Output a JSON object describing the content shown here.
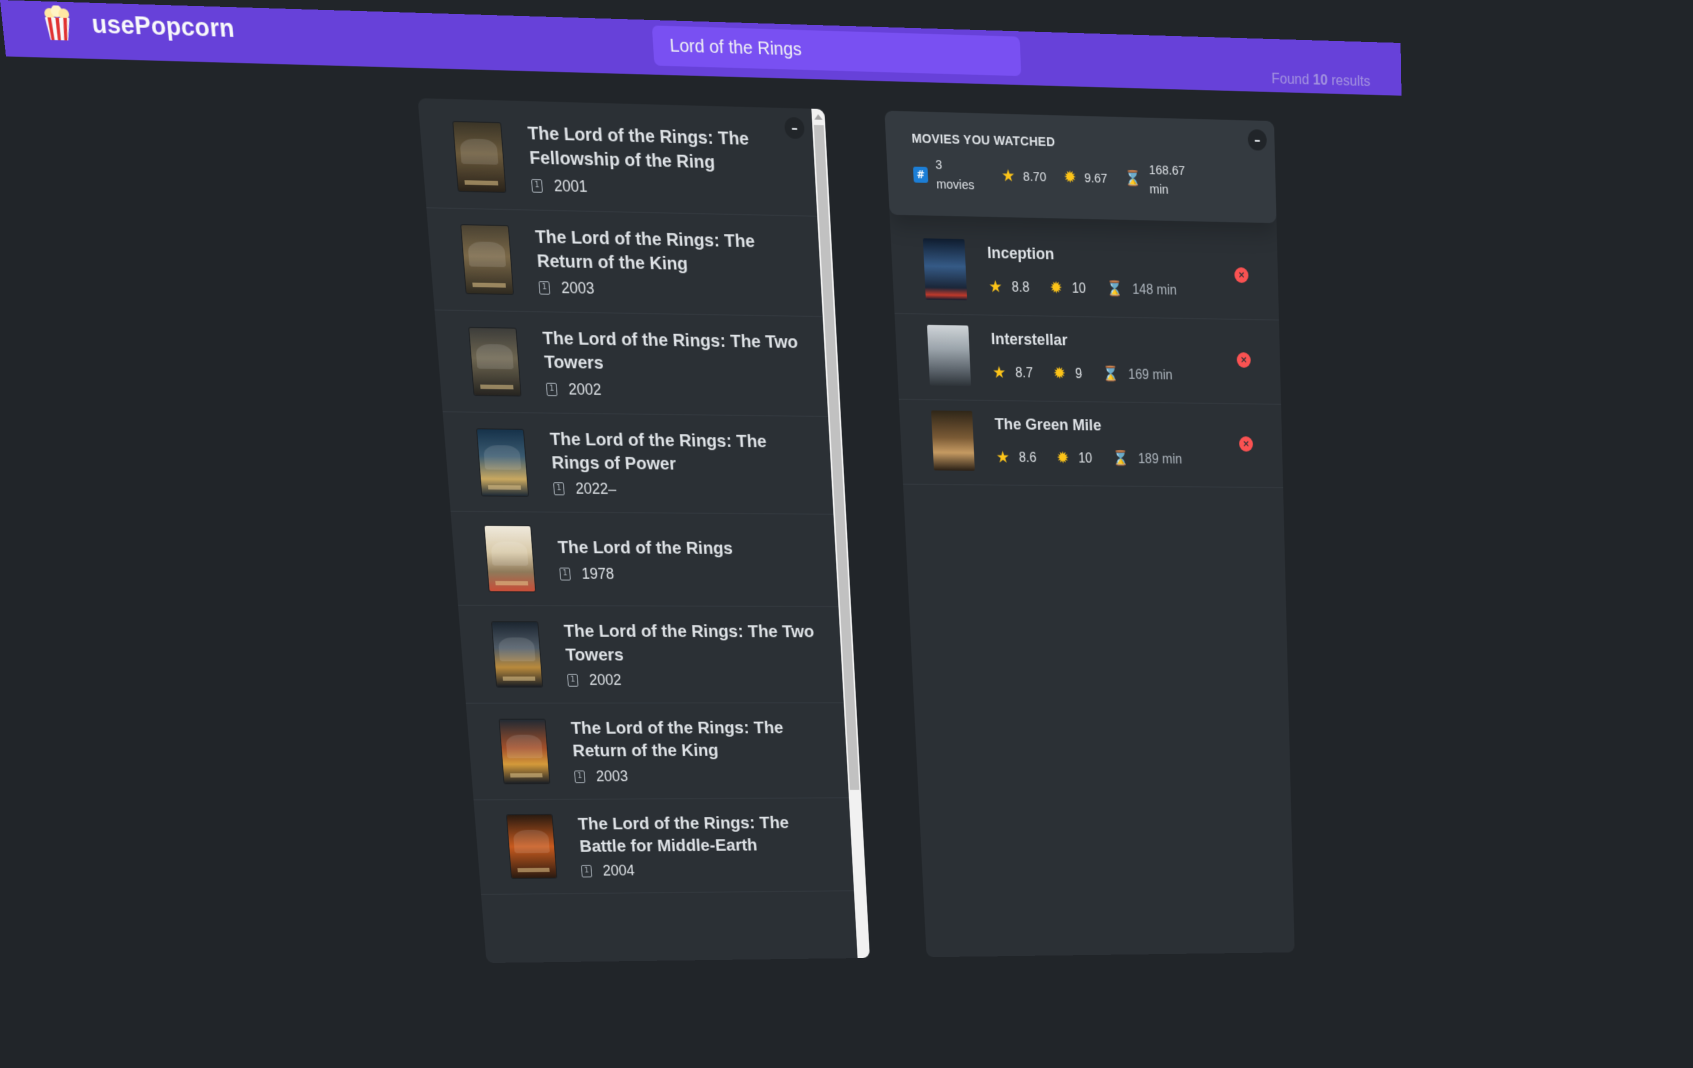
{
  "app": {
    "name": "usePopcorn",
    "logo_icon": "popcorn-icon",
    "accent_color": "#6741d9"
  },
  "search": {
    "value": "Lord of the Rings",
    "placeholder": "Search movies..."
  },
  "results": {
    "prefix": "Found",
    "count": "10",
    "suffix": "results"
  },
  "movie_list": {
    "toggle_label": "–",
    "items": [
      {
        "title": "The Lord of the Rings: The Fellowship of the Ring",
        "year": "2001"
      },
      {
        "title": "The Lord of the Rings: The Return of the King",
        "year": "2003"
      },
      {
        "title": "The Lord of the Rings: The Two Towers",
        "year": "2002"
      },
      {
        "title": "The Lord of the Rings: The Rings of Power",
        "year": "2022–"
      },
      {
        "title": "The Lord of the Rings",
        "year": "1978"
      },
      {
        "title": "The Lord of the Rings: The Two Towers",
        "year": "2002"
      },
      {
        "title": "The Lord of the Rings: The Return of the King",
        "year": "2003"
      },
      {
        "title": "The Lord of the Rings: The Battle for Middle-Earth",
        "year": "2004"
      }
    ]
  },
  "watched": {
    "toggle_label": "–",
    "summary": {
      "heading": "Movies you watched",
      "count": "3 movies",
      "avg_imdb_rating": "8.70",
      "avg_user_rating": "9.67",
      "avg_runtime": "168.67 min"
    },
    "items": [
      {
        "title": "Inception",
        "imdb_rating": "8.8",
        "user_rating": "10",
        "runtime": "148 min"
      },
      {
        "title": "Interstellar",
        "imdb_rating": "8.7",
        "user_rating": "9",
        "runtime": "169 min"
      },
      {
        "title": "The Green Mile",
        "imdb_rating": "8.6",
        "user_rating": "10",
        "runtime": "189 min"
      }
    ],
    "delete_label": "×"
  },
  "icons": {
    "calendar": "calendar-icon",
    "count": "hash-icon",
    "imdb_rating": "star-icon",
    "user_rating": "sun-icon",
    "runtime": "hourglass-icon"
  }
}
